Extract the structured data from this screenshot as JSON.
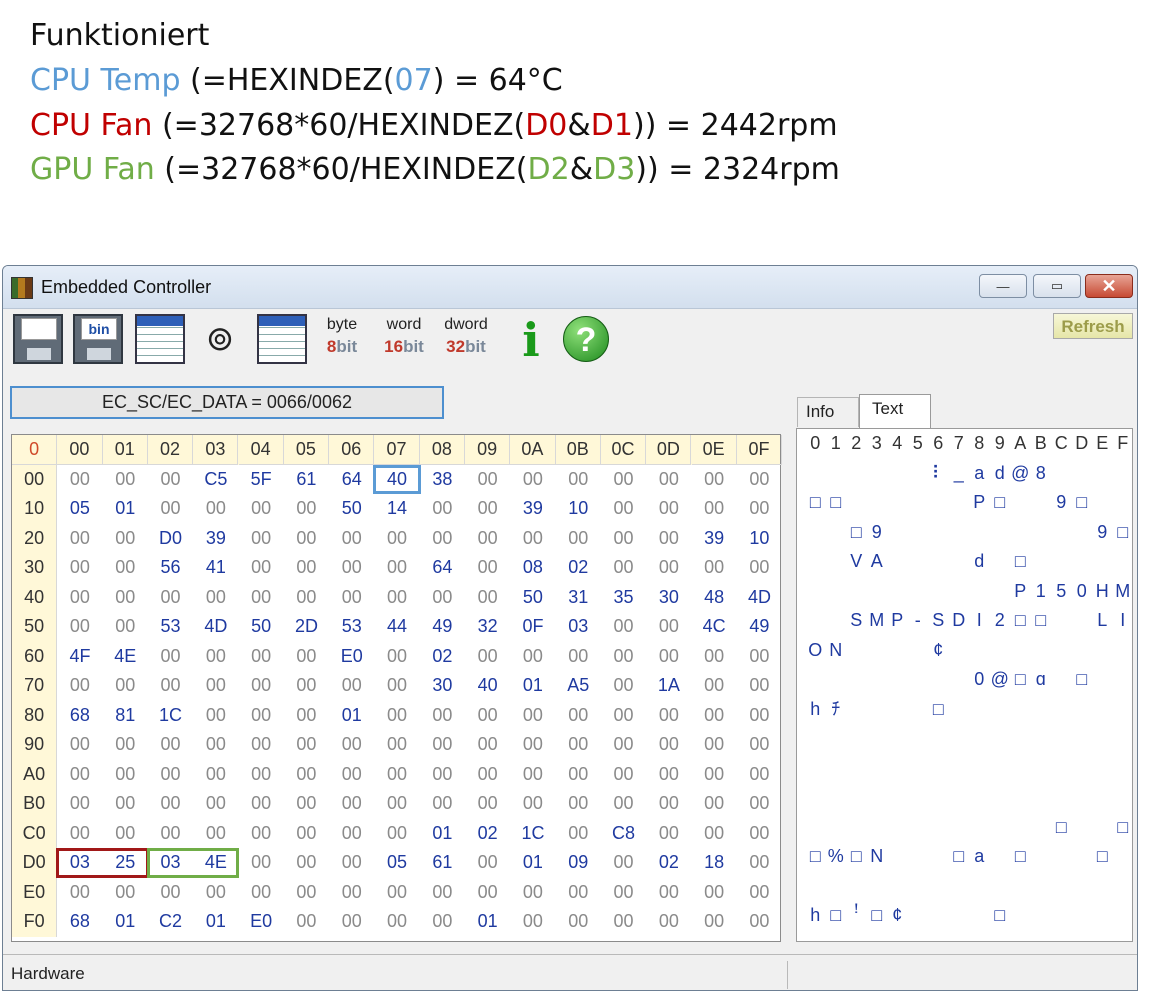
{
  "annotation": {
    "line1": "Funktioniert",
    "cpu_temp": {
      "label": "CPU Temp",
      "pre": " (=HEXINDEZ(",
      "reg": "07",
      "post": ") = 64°C"
    },
    "cpu_fan": {
      "label": "CPU Fan",
      "pre": " (=32768*60/HEXINDEZ(",
      "reg1": "D0",
      "amp": "&",
      "reg2": "D1",
      "post": ")) = 2442rpm"
    },
    "gpu_fan": {
      "label": "GPU Fan",
      "pre": " (=32768*60/HEXINDEZ(",
      "reg1": "D2",
      "amp": "&",
      "reg2": "D3",
      "post": ")) = 2324rpm"
    },
    "colors": {
      "cpu_temp": "#5b9bd5",
      "cpu_fan": "#c00000",
      "gpu_fan": "#70ad47"
    }
  },
  "window": {
    "title": "Embedded Controller",
    "minimize": "—",
    "maximize": "▭",
    "close": "✕"
  },
  "toolbar": {
    "save_label": "",
    "bin_label": "bin",
    "byte_top": "byte",
    "byte_num": "8",
    "byte_bit": "bit",
    "word_top": "word",
    "word_num": "16",
    "word_bit": "bit",
    "dword_top": "dword",
    "dword_num": "32",
    "dword_bit": "bit",
    "info_label": "i",
    "help_label": "?",
    "refresh_label": "Refresh"
  },
  "address_field": "EC_SC/EC_DATA = 0066/0062",
  "tabs": [
    {
      "label": "Info"
    },
    {
      "label": "Text"
    }
  ],
  "hex": {
    "corner": "0",
    "columns": [
      "00",
      "01",
      "02",
      "03",
      "04",
      "05",
      "06",
      "07",
      "08",
      "09",
      "0A",
      "0B",
      "0C",
      "0D",
      "0E",
      "0F"
    ],
    "rows": [
      {
        "addr": "00",
        "cells": [
          "00",
          "00",
          "00",
          "C5",
          "5F",
          "61",
          "64",
          "40",
          "38",
          "00",
          "00",
          "00",
          "00",
          "00",
          "00",
          "00"
        ]
      },
      {
        "addr": "10",
        "cells": [
          "05",
          "01",
          "00",
          "00",
          "00",
          "00",
          "50",
          "14",
          "00",
          "00",
          "39",
          "10",
          "00",
          "00",
          "00",
          "00"
        ]
      },
      {
        "addr": "20",
        "cells": [
          "00",
          "00",
          "D0",
          "39",
          "00",
          "00",
          "00",
          "00",
          "00",
          "00",
          "00",
          "00",
          "00",
          "00",
          "39",
          "10"
        ]
      },
      {
        "addr": "30",
        "cells": [
          "00",
          "00",
          "56",
          "41",
          "00",
          "00",
          "00",
          "00",
          "64",
          "00",
          "08",
          "02",
          "00",
          "00",
          "00",
          "00"
        ]
      },
      {
        "addr": "40",
        "cells": [
          "00",
          "00",
          "00",
          "00",
          "00",
          "00",
          "00",
          "00",
          "00",
          "00",
          "50",
          "31",
          "35",
          "30",
          "48",
          "4D"
        ]
      },
      {
        "addr": "50",
        "cells": [
          "00",
          "00",
          "53",
          "4D",
          "50",
          "2D",
          "53",
          "44",
          "49",
          "32",
          "0F",
          "03",
          "00",
          "00",
          "4C",
          "49"
        ]
      },
      {
        "addr": "60",
        "cells": [
          "4F",
          "4E",
          "00",
          "00",
          "00",
          "00",
          "E0",
          "00",
          "02",
          "00",
          "00",
          "00",
          "00",
          "00",
          "00",
          "00"
        ]
      },
      {
        "addr": "70",
        "cells": [
          "00",
          "00",
          "00",
          "00",
          "00",
          "00",
          "00",
          "00",
          "30",
          "40",
          "01",
          "A5",
          "00",
          "1A",
          "00",
          "00"
        ]
      },
      {
        "addr": "80",
        "cells": [
          "68",
          "81",
          "1C",
          "00",
          "00",
          "00",
          "01",
          "00",
          "00",
          "00",
          "00",
          "00",
          "00",
          "00",
          "00",
          "00"
        ]
      },
      {
        "addr": "90",
        "cells": [
          "00",
          "00",
          "00",
          "00",
          "00",
          "00",
          "00",
          "00",
          "00",
          "00",
          "00",
          "00",
          "00",
          "00",
          "00",
          "00"
        ]
      },
      {
        "addr": "A0",
        "cells": [
          "00",
          "00",
          "00",
          "00",
          "00",
          "00",
          "00",
          "00",
          "00",
          "00",
          "00",
          "00",
          "00",
          "00",
          "00",
          "00"
        ]
      },
      {
        "addr": "B0",
        "cells": [
          "00",
          "00",
          "00",
          "00",
          "00",
          "00",
          "00",
          "00",
          "00",
          "00",
          "00",
          "00",
          "00",
          "00",
          "00",
          "00"
        ]
      },
      {
        "addr": "C0",
        "cells": [
          "00",
          "00",
          "00",
          "00",
          "00",
          "00",
          "00",
          "00",
          "01",
          "02",
          "1C",
          "00",
          "C8",
          "00",
          "00",
          "00"
        ]
      },
      {
        "addr": "D0",
        "cells": [
          "03",
          "25",
          "03",
          "4E",
          "00",
          "00",
          "00",
          "05",
          "61",
          "00",
          "01",
          "09",
          "00",
          "02",
          "18",
          "00"
        ]
      },
      {
        "addr": "E0",
        "cells": [
          "00",
          "00",
          "00",
          "00",
          "00",
          "00",
          "00",
          "00",
          "00",
          "00",
          "00",
          "00",
          "00",
          "00",
          "00",
          "00"
        ]
      },
      {
        "addr": "F0",
        "cells": [
          "68",
          "01",
          "C2",
          "01",
          "E0",
          "00",
          "00",
          "00",
          "00",
          "01",
          "00",
          "00",
          "00",
          "00",
          "00",
          "00"
        ]
      }
    ]
  },
  "text_panel": {
    "header": [
      "0",
      "1",
      "2",
      "3",
      "4",
      "5",
      "6",
      "7",
      "8",
      "9",
      "A",
      "B",
      "C",
      "D",
      "E",
      "F"
    ],
    "rows": [
      [
        "",
        "",
        "",
        "",
        "",
        "",
        "",
        "",
        "",
        "",
        "",
        "",
        "",
        "",
        "",
        ""
      ],
      [
        "",
        "",
        "",
        "",
        "",
        "",
        "⠇",
        "_",
        "a",
        "d",
        "@",
        "8",
        "",
        "",
        "",
        ""
      ],
      [
        "□",
        "□",
        "",
        "",
        "",
        "",
        "",
        "",
        "P",
        "□",
        "",
        "",
        "9",
        "□",
        "",
        ""
      ],
      [
        "",
        "",
        "□",
        "9",
        "",
        "",
        "",
        "",
        "",
        "",
        "",
        "",
        "",
        "",
        "9",
        "□"
      ],
      [
        "",
        "",
        "V",
        "A",
        "",
        "",
        "",
        "",
        "d",
        "",
        "□",
        "",
        "",
        "",
        "",
        ""
      ],
      [
        "",
        "",
        "",
        "",
        "",
        "",
        "",
        "",
        "",
        "",
        "P",
        "1",
        "5",
        "0",
        "H",
        "M"
      ],
      [
        "",
        "",
        "S",
        "M",
        "P",
        "-",
        "S",
        "D",
        "I",
        "2",
        "□",
        "□",
        "",
        "",
        "L",
        "I"
      ],
      [
        "O",
        "N",
        "",
        "",
        "",
        "",
        "¢",
        "",
        "",
        "",
        "",
        "",
        "",
        "",
        "",
        ""
      ],
      [
        "",
        "",
        "",
        "",
        "",
        "",
        "",
        "",
        "0",
        "@",
        "□",
        "ɑ",
        "",
        "□",
        "",
        ""
      ],
      [
        "h",
        "ﾁ",
        "",
        "",
        "",
        "",
        "□",
        "",
        "",
        "",
        "",
        "",
        "",
        "",
        "",
        ""
      ],
      [
        "",
        "",
        "",
        "",
        "",
        "",
        "",
        "",
        "",
        "",
        "",
        "",
        "",
        "",
        "",
        ""
      ],
      [
        "",
        "",
        "",
        "",
        "",
        "",
        "",
        "",
        "",
        "",
        "",
        "",
        "",
        "",
        "",
        ""
      ],
      [
        "",
        "",
        "",
        "",
        "",
        "",
        "",
        "",
        "",
        "",
        "",
        "",
        "",
        "",
        "",
        ""
      ],
      [
        "",
        "",
        "",
        "",
        "",
        "",
        "",
        "",
        "",
        "",
        "",
        "",
        "□",
        "",
        "",
        "□"
      ],
      [
        "□",
        "%",
        "□",
        "N",
        "",
        "",
        "",
        "□",
        "a",
        "",
        "□",
        "",
        "",
        "",
        "□",
        ""
      ],
      [
        "",
        "",
        "",
        "",
        "",
        "",
        "",
        "",
        "",
        "",
        "",
        "",
        "",
        "",
        "",
        ""
      ],
      [
        "h",
        "□",
        "ꜝ",
        "□",
        "¢",
        "",
        "",
        "",
        "",
        "□",
        "",
        "",
        "",
        "",
        "",
        ""
      ]
    ]
  },
  "status": {
    "left": "Hardware",
    "right": ""
  }
}
